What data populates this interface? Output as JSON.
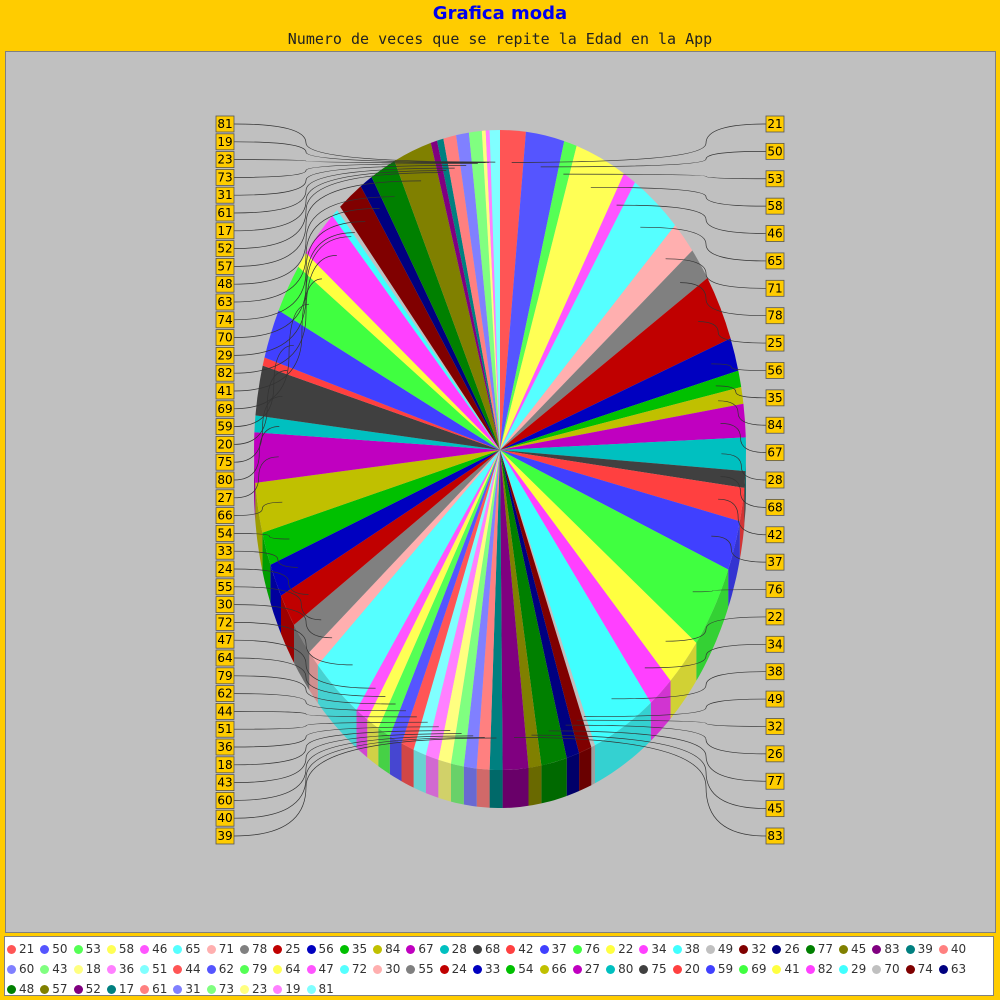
{
  "title": "Grafica moda",
  "subtitle": "Numero de veces que se repite la Edad en la App",
  "colors": {
    "background": "#ffcc00",
    "plot_background": "#c0c0c0",
    "label_box": "#ffcc00",
    "title": "#0000ee"
  },
  "chart_data": {
    "type": "pie",
    "style": "3d",
    "title": "Grafica moda",
    "subtitle": "Numero de veces que se repite la Edad en la App",
    "legend_position": "bottom",
    "slices": [
      {
        "label": "21",
        "value": 2,
        "color": "#ff5555"
      },
      {
        "label": "50",
        "value": 3,
        "color": "#5555ff"
      },
      {
        "label": "53",
        "value": 1,
        "color": "#55ff55"
      },
      {
        "label": "58",
        "value": 4,
        "color": "#ffff55"
      },
      {
        "label": "46",
        "value": 1,
        "color": "#ff55ff"
      },
      {
        "label": "65",
        "value": 4,
        "color": "#55ffff"
      },
      {
        "label": "71",
        "value": 2,
        "color": "#ffafaf"
      },
      {
        "label": "78",
        "value": 2,
        "color": "#808080"
      },
      {
        "label": "25",
        "value": 4,
        "color": "#c00000"
      },
      {
        "label": "56",
        "value": 2,
        "color": "#0000c0"
      },
      {
        "label": "35",
        "value": 1,
        "color": "#00c000"
      },
      {
        "label": "84",
        "value": 1,
        "color": "#c0c000"
      },
      {
        "label": "67",
        "value": 2,
        "color": "#c000c0"
      },
      {
        "label": "28",
        "value": 2,
        "color": "#00c0c0"
      },
      {
        "label": "68",
        "value": 1,
        "color": "#404040"
      },
      {
        "label": "42",
        "value": 2,
        "color": "#ff4040"
      },
      {
        "label": "37",
        "value": 3,
        "color": "#4040ff"
      },
      {
        "label": "76",
        "value": 5,
        "color": "#40ff40"
      },
      {
        "label": "22",
        "value": 3,
        "color": "#ffff40"
      },
      {
        "label": "34",
        "value": 2,
        "color": "#ff40ff"
      },
      {
        "label": "38",
        "value": 5,
        "color": "#40ffff"
      },
      {
        "label": "49",
        "value": 0.3,
        "color": "#c0c0c0"
      },
      {
        "label": "32",
        "value": 1,
        "color": "#800000"
      },
      {
        "label": "26",
        "value": 1,
        "color": "#000080"
      },
      {
        "label": "77",
        "value": 2,
        "color": "#008000"
      },
      {
        "label": "45",
        "value": 1,
        "color": "#808000"
      },
      {
        "label": "83",
        "value": 2,
        "color": "#800080"
      },
      {
        "label": "39",
        "value": 1,
        "color": "#008080"
      },
      {
        "label": "40",
        "value": 1,
        "color": "#ff8080"
      },
      {
        "label": "60",
        "value": 1,
        "color": "#8080ff"
      },
      {
        "label": "43",
        "value": 1,
        "color": "#80ff80"
      },
      {
        "label": "18",
        "value": 1,
        "color": "#ffff80"
      },
      {
        "label": "36",
        "value": 1,
        "color": "#ff80ff"
      },
      {
        "label": "51",
        "value": 1,
        "color": "#80ffff"
      },
      {
        "label": "44",
        "value": 1,
        "color": "#ff5555"
      },
      {
        "label": "62",
        "value": 1,
        "color": "#5555ff"
      },
      {
        "label": "79",
        "value": 1,
        "color": "#55ff55"
      },
      {
        "label": "64",
        "value": 1,
        "color": "#ffff55"
      },
      {
        "label": "47",
        "value": 1,
        "color": "#ff55ff"
      },
      {
        "label": "72",
        "value": 4,
        "color": "#55ffff"
      },
      {
        "label": "30",
        "value": 1,
        "color": "#ffafaf"
      },
      {
        "label": "55",
        "value": 2,
        "color": "#808080"
      },
      {
        "label": "24",
        "value": 2,
        "color": "#c00000"
      },
      {
        "label": "33",
        "value": 2,
        "color": "#0000c0"
      },
      {
        "label": "54",
        "value": 2,
        "color": "#00c000"
      },
      {
        "label": "66",
        "value": 3,
        "color": "#c0c000"
      },
      {
        "label": "27",
        "value": 3,
        "color": "#c000c0"
      },
      {
        "label": "80",
        "value": 1,
        "color": "#00c0c0"
      },
      {
        "label": "75",
        "value": 3,
        "color": "#404040"
      },
      {
        "label": "20",
        "value": 0.5,
        "color": "#ff4040"
      },
      {
        "label": "59",
        "value": 3,
        "color": "#4040ff"
      },
      {
        "label": "69",
        "value": 3,
        "color": "#40ff40"
      },
      {
        "label": "41",
        "value": 1,
        "color": "#ffff40"
      },
      {
        "label": "82",
        "value": 3,
        "color": "#ff40ff"
      },
      {
        "label": "29",
        "value": 0.5,
        "color": "#40ffff"
      },
      {
        "label": "70",
        "value": 0.3,
        "color": "#c0c0c0"
      },
      {
        "label": "74",
        "value": 2,
        "color": "#800000"
      },
      {
        "label": "63",
        "value": 1,
        "color": "#000080"
      },
      {
        "label": "48",
        "value": 2,
        "color": "#008000"
      },
      {
        "label": "57",
        "value": 3,
        "color": "#808000"
      },
      {
        "label": "52",
        "value": 0.5,
        "color": "#800080"
      },
      {
        "label": "17",
        "value": 0.5,
        "color": "#008080"
      },
      {
        "label": "61",
        "value": 1,
        "color": "#ff8080"
      },
      {
        "label": "31",
        "value": 1,
        "color": "#8080ff"
      },
      {
        "label": "73",
        "value": 1,
        "color": "#80ff80"
      },
      {
        "label": "23",
        "value": 0.3,
        "color": "#ffff80"
      },
      {
        "label": "19",
        "value": 0.3,
        "color": "#ff80ff"
      },
      {
        "label": "81",
        "value": 0.8,
        "color": "#80ffff"
      }
    ]
  }
}
